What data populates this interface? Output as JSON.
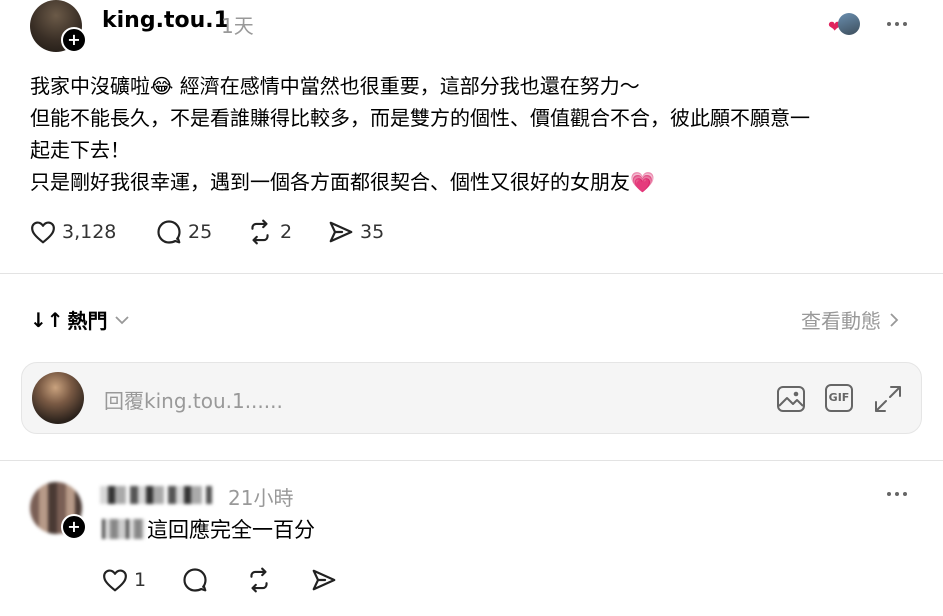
{
  "post": {
    "username": "king.tou.1",
    "time": "1天",
    "lines": [
      "我家中沒礦啦😂 經濟在感情中當然也很重要，這部分我也還在努力～",
      "但能不能長久，不是看誰賺得比較多，而是雙方的個性、價值觀合不合，彼此願不願意一",
      "起走下去！",
      "只是剛好我很幸運，遇到一個各方面都很契合、個性又很好的女朋友💗"
    ],
    "likes": "3,128",
    "comments": "25",
    "reposts": "2",
    "shares": "35"
  },
  "sort": {
    "label": "熱門",
    "activity_link": "查看動態"
  },
  "reply": {
    "placeholder": "回覆king.tou.1......"
  },
  "comment": {
    "time": "21小時",
    "text": "這回應完全一百分",
    "likes": "1"
  },
  "colors": {
    "heart": "#e0245e",
    "text": "#000000",
    "muted": "#999999"
  }
}
